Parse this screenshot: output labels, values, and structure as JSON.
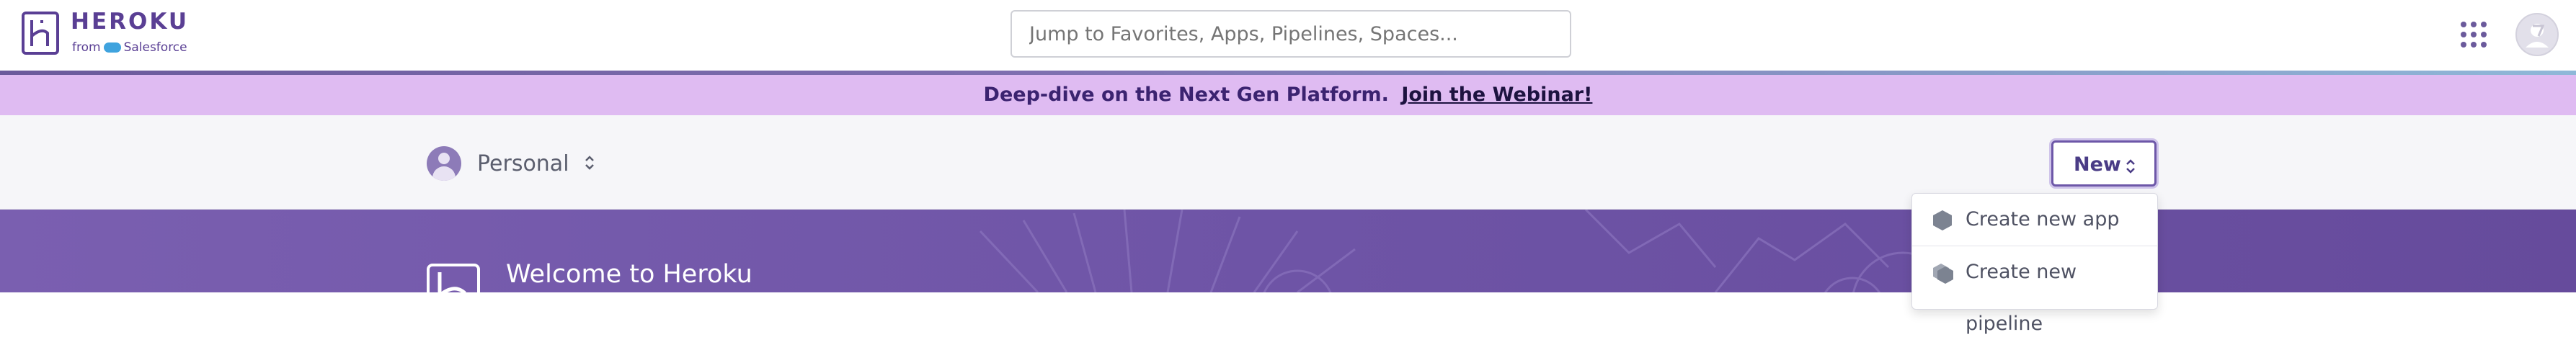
{
  "header": {
    "logo_text": "HEROKU",
    "logo_sub_from": "from",
    "logo_sub_brand": "Salesforce",
    "search_placeholder": "Jump to Favorites, Apps, Pipelines, Spaces...",
    "apps_icon": "grid-dots-icon",
    "avatar_icon": "user-avatar-icon"
  },
  "banner": {
    "text": "Deep-dive on the Next Gen Platform.",
    "link": "Join the Webinar!"
  },
  "account": {
    "name": "Personal"
  },
  "new_button": {
    "label": "New"
  },
  "dropdown": {
    "items": [
      {
        "label": "Create new app",
        "icon": "hexagon-icon"
      },
      {
        "label": "Create new pipeline",
        "icon": "pipeline-hexagon-icon"
      }
    ]
  },
  "hero": {
    "title": "Welcome to Heroku"
  },
  "colors": {
    "brand_purple": "#5a3f94",
    "banner_bg": "#dfbbf2",
    "hero_bg": "#7a5fb0"
  }
}
